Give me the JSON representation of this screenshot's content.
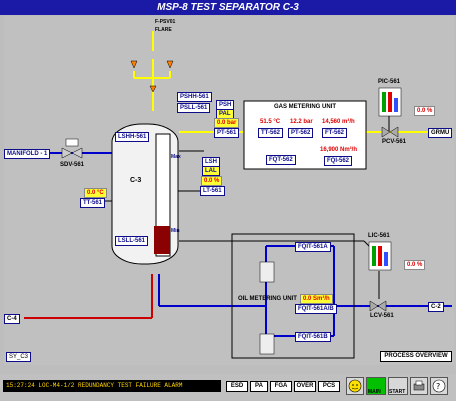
{
  "title": "MSP-8  TEST SEPARATOR C-3",
  "flare": {
    "valve": "F-PSV01",
    "label": "FLARE"
  },
  "vessel": {
    "name": "C-3",
    "lshh": "LSHH-561",
    "lsll": "LSLL-561",
    "max": "Max",
    "min": "Min"
  },
  "inlet": {
    "manifold": "MANIFOLD - 1",
    "sdv": "SDV-561"
  },
  "pressure": {
    "pshh": "PSHH-561",
    "psll": "PSLL-561",
    "psh": "PSH",
    "pal": "PAL",
    "value": "0.0 bar",
    "pt": "PT-561"
  },
  "level": {
    "lsh": "LSH",
    "lal": "LAL",
    "value": "0.0 %",
    "lt": "LT-561"
  },
  "temperature": {
    "value": "0.0 °C",
    "tt": "TT-561"
  },
  "gas_metering": {
    "title": "GAS METERING UNIT",
    "temp": "51.5 °C",
    "press": "12.2 bar",
    "flow": "14,560 m³/h",
    "tt": "TT-562",
    "pt": "PT-562",
    "ft": "FT-562",
    "fqt": "FQT-562",
    "total": "16,900 Nm³/h",
    "fqi": "FQI-562"
  },
  "pic": {
    "tag": "PIC-561",
    "value": "0.0 %",
    "pcv": "PCV-561",
    "outlet": "GRMU"
  },
  "oil_metering": {
    "title": "OIL METERING UNIT",
    "fqit_a": "FQIT-561A",
    "fqit_b": "FQIT-561B",
    "value": "0.0 Sm³/h",
    "fqit_ab": "FQIT-561A/B"
  },
  "lic": {
    "tag": "LIC-561",
    "value": "0.0 %",
    "lcv": "LCV-561",
    "outlet": "C-2"
  },
  "drain": "C-4",
  "sy_label": "SY_C3",
  "process_overview": "PROCESS OVERVIEW",
  "status": {
    "alarm_text": "15:27:24 LOC-M4-1/2 REDUNDANCY TEST FAILURE      ALARM",
    "buttons": [
      "ESD",
      "PA",
      "FGA",
      "OVER",
      "PCS"
    ],
    "main": "MAIN",
    "start": "START"
  },
  "colors": {
    "title_bg": "#1a1aa6",
    "pipe_gas": "#ffff00",
    "pipe_liquid": "#0000cc",
    "pipe_drain": "#cc0000",
    "tag_border": "#0d0d8c"
  }
}
